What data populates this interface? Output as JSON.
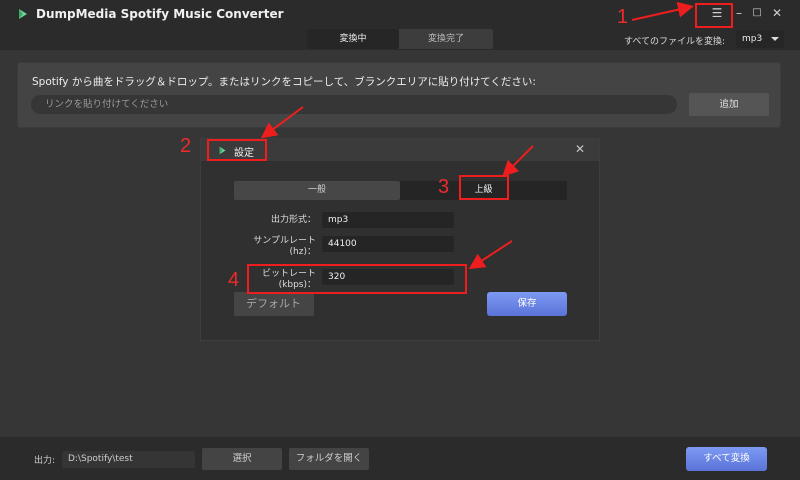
{
  "app": {
    "title": "DumpMedia Spotify Music Converter"
  },
  "window_controls": {
    "menu": "☰",
    "minimize": "–",
    "maximize": "□",
    "close": "✕"
  },
  "tabs": [
    {
      "label": "変換中"
    },
    {
      "label": "変換完了"
    }
  ],
  "convert_all_format": {
    "label": "すべてのファイルを変換:",
    "value": "mp3"
  },
  "drop_zone": {
    "instruction": "Spotify から曲をドラッグ＆ドロップ。またはリンクをコピーして、ブランクエリアに貼り付けてください:",
    "placeholder": "リンクを貼り付けてください",
    "add_label": "追加"
  },
  "settings_dialog": {
    "title": "設定",
    "close": "✕",
    "tabs": [
      {
        "label": "一般"
      },
      {
        "label": "上級"
      }
    ],
    "fields": [
      {
        "label": "出力形式：",
        "value": "mp3"
      },
      {
        "label": "サンプルレート (hz)：",
        "value": "44100"
      },
      {
        "label": "ビットレート (kbps)：",
        "value": "320"
      }
    ],
    "default_label": "デフォルト",
    "save_label": "保存"
  },
  "bottom": {
    "output_label": "出力:",
    "output_path": "D:\\Spotify\\test",
    "select_label": "選択",
    "open_folder_label": "フォルダを開く",
    "convert_all_label": "すべて変換"
  },
  "annotations": [
    {
      "number": "1"
    },
    {
      "number": "2"
    },
    {
      "number": "3"
    },
    {
      "number": "4"
    }
  ],
  "colors": {
    "accent": "#6a86e6",
    "annotation": "#ee1e1e"
  }
}
